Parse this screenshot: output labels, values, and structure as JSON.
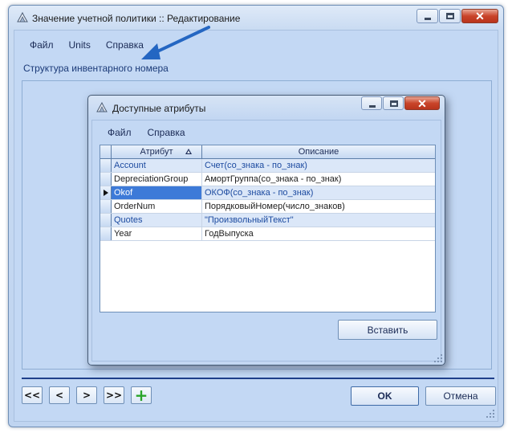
{
  "main_window": {
    "title": "Значение учетной политики :: Редактирование",
    "menu": [
      "Файл",
      "Units",
      "Справка"
    ],
    "caption": "Структура инвентарного номера",
    "nav_buttons": [
      "<<",
      "<",
      ">",
      ">>",
      "+"
    ],
    "ok_label": "OK",
    "cancel_label": "Отмена"
  },
  "dialog": {
    "title": "Доступные атрибуты",
    "menu": [
      "Файл",
      "Справка"
    ],
    "columns": [
      "Атрибут",
      "Описание"
    ],
    "sort_column": "Атрибут",
    "rows": [
      {
        "attr": "Account",
        "desc": "Счет(со_знака - по_знак)",
        "highlight": true
      },
      {
        "attr": "DepreciationGroup",
        "desc": "АмортГруппа(со_знака - по_знак)",
        "highlight": false
      },
      {
        "attr": "Okof",
        "desc": "ОКОФ(со_знака - по_знак)",
        "highlight": true,
        "current": true
      },
      {
        "attr": "OrderNum",
        "desc": "ПорядковыйНомер(число_знаков)",
        "highlight": false
      },
      {
        "attr": "Quotes",
        "desc": "\"ПроизвольныйТекст\"",
        "highlight": true
      },
      {
        "attr": "Year",
        "desc": "ГодВыпуска",
        "highlight": false
      }
    ],
    "insert_label": "Вставить"
  },
  "colors": {
    "client_bg": "#c3d8f4",
    "accent_arrow": "#2466c2",
    "selection": "#3d7ad8",
    "highlight_text": "#1d4ba0"
  }
}
